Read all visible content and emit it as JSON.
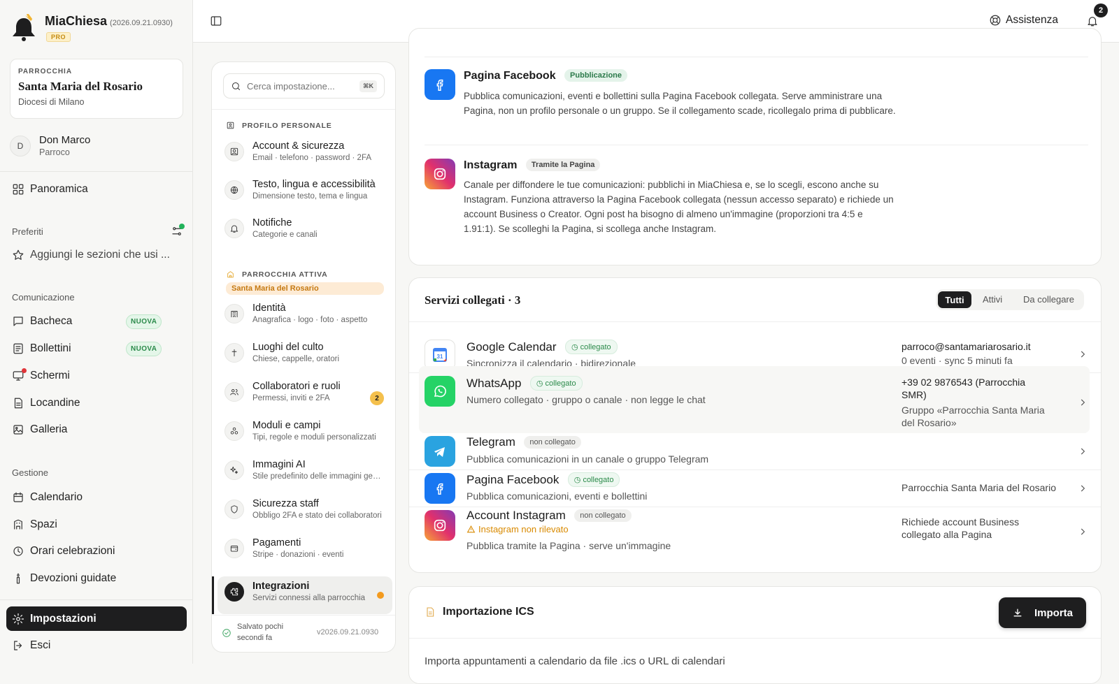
{
  "app": {
    "name": "MiaChiesa",
    "version": "(2026.09.21.0930)",
    "plan": "PRO"
  },
  "parish": {
    "kicker": "PARROCCHIA",
    "name": "Santa Maria del Rosario",
    "diocese": "Diocesi di Milano"
  },
  "user": {
    "initial": "D",
    "name": "Don Marco",
    "role": "Parroco"
  },
  "sidebar": {
    "overview": "Panoramica",
    "favorites_title": "Preferiti",
    "favorites_add": "Aggiungi le sezioni che usi ...",
    "comm_title": "Comunicazione",
    "comm_items": [
      {
        "label": "Bacheca",
        "badge": "NUOVA"
      },
      {
        "label": "Bollettini",
        "badge": "NUOVA"
      },
      {
        "label": "Schermi"
      },
      {
        "label": "Locandine"
      },
      {
        "label": "Galleria"
      }
    ],
    "mgmt_title": "Gestione",
    "mgmt_items": [
      {
        "label": "Calendario"
      },
      {
        "label": "Spazi"
      },
      {
        "label": "Orari celebrazioni"
      },
      {
        "label": "Devozioni guidate"
      }
    ],
    "settings": "Impostazioni",
    "logout": "Esci"
  },
  "header": {
    "help": "Assistenza",
    "notifications_count": "2"
  },
  "settings_panel": {
    "search_placeholder": "Cerca impostazione...",
    "search_kbd": "⌘K",
    "personal_title": "PROFILO PERSONALE",
    "personal_items": [
      {
        "title": "Account & sicurezza",
        "sub": "Email · telefono · password · 2FA"
      },
      {
        "title": "Testo, lingua e accessibilità",
        "sub": "Dimensione testo, tema e lingua"
      },
      {
        "title": "Notifiche",
        "sub": "Categorie e canali"
      }
    ],
    "parish_title": "PARROCCHIA ATTIVA",
    "parish_chip": "Santa Maria del Rosario",
    "parish_items": [
      {
        "title": "Identità",
        "sub": "Anagrafica · logo · foto · aspetto"
      },
      {
        "title": "Luoghi del culto",
        "sub": "Chiese, cappelle, oratori"
      },
      {
        "title": "Collaboratori e ruoli",
        "sub": "Permessi, inviti e 2FA",
        "badge": "2"
      },
      {
        "title": "Moduli e campi",
        "sub": "Tipi, regole e moduli personalizzati"
      },
      {
        "title": "Immagini AI",
        "sub": "Stile predefinito delle immagini generate"
      },
      {
        "title": "Sicurezza staff",
        "sub": "Obbligo 2FA e stato dei collaboratori"
      },
      {
        "title": "Pagamenti",
        "sub": "Stripe · donazioni · eventi"
      },
      {
        "title": "Integrazioni",
        "sub": "Servizi connessi alla parrocchia"
      }
    ],
    "saved": "Salvato pochi secondi fa",
    "version": "v2026.09.21.0930"
  },
  "channels": {
    "facebook": {
      "title": "Pagina Facebook",
      "pill": "Pubblicazione",
      "desc": "Pubblica comunicazioni, eventi e bollettini sulla Pagina Facebook collegata. Serve amministrare una Pagina, non un profilo personale o un gruppo. Se il collegamento scade, ricollegalo prima di pubblicare."
    },
    "instagram": {
      "title": "Instagram",
      "pill": "Tramite la Pagina",
      "desc": "Canale per diffondere le tue comunicazioni: pubblichi in MiaChiesa e, se lo scegli, escono anche su Instagram. Funziona attraverso la Pagina Facebook collegata (nessun accesso separato) e richiede un account Business o Creator. Ogni post ha bisogno di almeno un'immagine (proporzioni tra 4:5 e 1.91:1). Se scolleghi la Pagina, si scollega anche Instagram."
    }
  },
  "services": {
    "title": "Servizi collegati · 3",
    "filters": [
      "Tutti",
      "Attivi",
      "Da collegare"
    ],
    "items": [
      {
        "name": "Google Calendar",
        "status": "collegato",
        "sub": "Sincronizza il calendario · bidirezionale",
        "meta1": "parroco@santamariarosario.it",
        "meta2": "0 eventi · sync 5 minuti fa"
      },
      {
        "name": "WhatsApp",
        "status": "collegato",
        "sub": "Numero collegato · gruppo o canale · non legge le chat",
        "meta1": "+39 02 9876543 (Parrocchia SMR)",
        "meta2": "Gruppo «Parrocchia Santa Maria del Rosario»"
      },
      {
        "name": "Telegram",
        "status": "non collegato",
        "sub": "Pubblica comunicazioni in un canale o gruppo Telegram"
      },
      {
        "name": "Pagina Facebook",
        "status": "collegato",
        "sub": "Pubblica comunicazioni, eventi e bollettini",
        "meta1": "Parrocchia Santa Maria del Rosario"
      },
      {
        "name": "Account Instagram",
        "status": "non collegato",
        "warning": "Instagram non rilevato",
        "sub": "Pubblica tramite la Pagina · serve un'immagine",
        "meta1": "Richiede account Business collegato alla Pagina"
      }
    ]
  },
  "ics": {
    "title": "Importazione ICS",
    "button": "Importa",
    "desc": "Importa appuntamenti a calendario da file .ics o URL di calendari"
  },
  "colors": {
    "accent_dark": "#1e1e1f",
    "connected_green": "#2b8a4a",
    "facebook": "#1877f2",
    "whatsapp": "#25d366",
    "telegram": "#2aa3e0",
    "warning": "#d98a00"
  },
  "icons": [
    "bell-icon",
    "sidebar-toggle-icon",
    "help-icon",
    "search-icon",
    "grid-icon",
    "star-icon",
    "message-icon",
    "newspaper-icon",
    "screen-icon",
    "poster-icon",
    "gallery-icon",
    "calendar-icon",
    "building-icon",
    "clock-icon",
    "candle-icon",
    "gear-icon",
    "logout-icon",
    "chevron-right-icon",
    "download-icon",
    "document-icon"
  ]
}
